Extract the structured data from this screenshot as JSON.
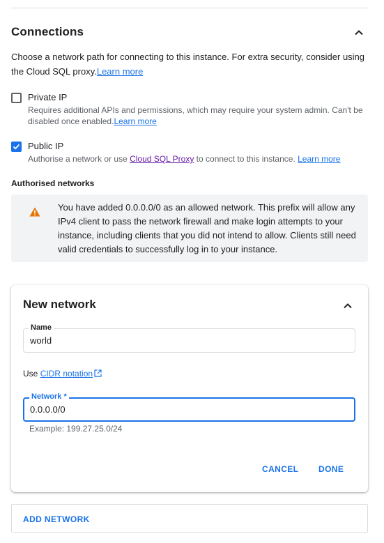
{
  "section": {
    "title": "Connections",
    "description": "Choose a network path for connecting to this instance. For extra security, consider using the Cloud SQL proxy.",
    "learn_more": "Learn more"
  },
  "private_ip": {
    "label": "Private IP",
    "checked": false,
    "help": "Requires additional APIs and permissions, which may require your system admin. Can't be disabled once enabled.",
    "learn_more": "Learn more"
  },
  "public_ip": {
    "label": "Public IP",
    "checked": true,
    "help_prefix": "Authorise a network or use ",
    "proxy_link": "Cloud SQL Proxy",
    "help_suffix": " to connect to this instance. ",
    "learn_more": "Learn more"
  },
  "authorised_networks": {
    "heading": "Authorised networks",
    "warning": "You have added 0.0.0.0/0 as an allowed network. This prefix will allow any IPv4 client to pass the network firewall and make login attempts to your instance, including clients that you did not intend to allow. Clients still need valid credentials to successfully log in to your instance."
  },
  "new_network": {
    "title": "New network",
    "name_label": "Name",
    "name_value": "world",
    "cidr_prefix": "Use ",
    "cidr_link": "CIDR notation",
    "network_label": "Network *",
    "network_value": "0.0.0.0/0",
    "example": "Example: 199.27.25.0/24",
    "cancel": "CANCEL",
    "done": "DONE"
  },
  "add_network": "ADD NETWORK",
  "colors": {
    "accent": "#1a73e8",
    "warning": "#e37400",
    "visited_link": "#681da8",
    "warning_bg": "#f1f3f4"
  },
  "icons": {
    "collapse": "chevron-up-icon",
    "warning": "warning-icon",
    "external": "open-in-new-icon",
    "check": "check-icon"
  }
}
